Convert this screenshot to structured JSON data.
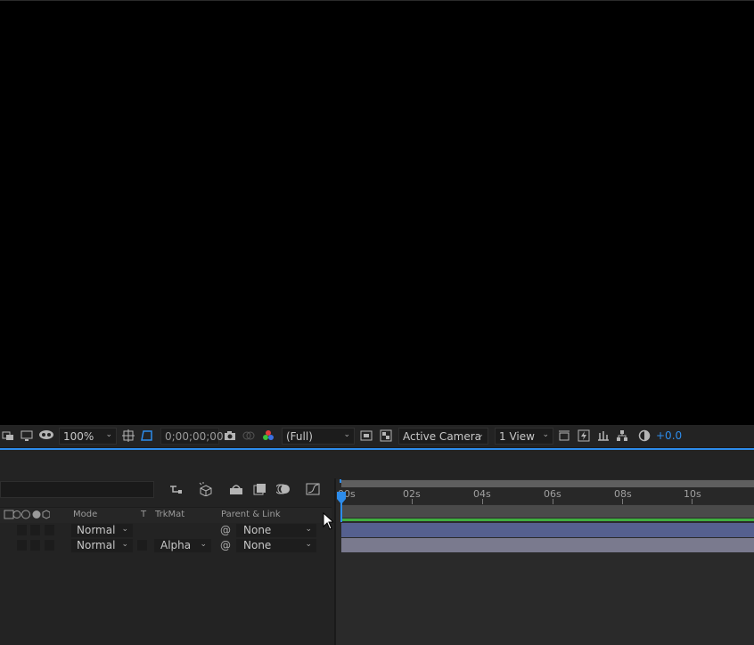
{
  "viewer": {
    "zoom": "100%",
    "timecode": "0;00;00;00",
    "resolution": "(Full)",
    "camera": "Active Camera",
    "views": "1 View",
    "exposure": "+0.0"
  },
  "icons": {
    "toolbar": [
      "region-icon",
      "display-icon",
      "mask-icon",
      "grid-icon",
      "roi-icon",
      "snapshot-icon",
      "show-snapshot-icon",
      "channel-icon",
      "fast-preview-icon",
      "transparency-icon",
      "reset-exposure-icon"
    ],
    "timeline": [
      "draft3d-icon",
      "shy-icon",
      "frame-blend-icon",
      "motion-blur-icon",
      "graph-editor-icon"
    ]
  },
  "timeline": {
    "columns": {
      "mode": "Mode",
      "t": "T",
      "trkmat": "TrkMat",
      "parent": "Parent & Link"
    },
    "ruler_labels": [
      "00s",
      "02s",
      "04s",
      "06s",
      "08s",
      "10s"
    ],
    "layers": [
      {
        "mode": "Normal",
        "trkmat": "",
        "parent": "None",
        "bar_color": "#55608f"
      },
      {
        "mode": "Normal",
        "trkmat": "Alpha",
        "parent": "None",
        "bar_color": "#7a7a8e"
      }
    ],
    "accent": "#2d8ceb",
    "workarea_color": "#3fae3f"
  }
}
